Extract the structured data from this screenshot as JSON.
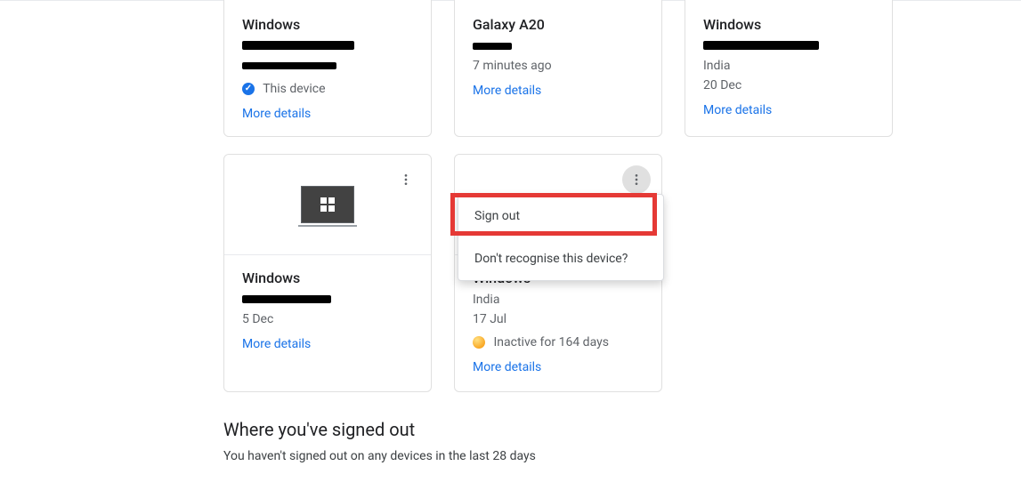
{
  "row1": {
    "c1": {
      "title": "Windows",
      "this_device": "This device",
      "more": "More details"
    },
    "c2": {
      "title": "Galaxy A20",
      "time": "7 minutes ago",
      "more": "More details"
    },
    "c3": {
      "title": "Windows",
      "loc": "India",
      "date": "20 Dec",
      "more": "More details"
    }
  },
  "row2": {
    "c1": {
      "title": "Windows",
      "date": "5 Dec",
      "more": "More details"
    },
    "c2": {
      "title": "Windows",
      "loc": "India",
      "date": "17 Jul",
      "inactive": "Inactive for 164 days",
      "more": "More details"
    }
  },
  "menu": {
    "sign_out": "Sign out",
    "dont_recognise": "Don't recognise this device?"
  },
  "section": {
    "title": "Where you've signed out",
    "sub": "You haven't signed out on any devices in the last 28 days"
  }
}
